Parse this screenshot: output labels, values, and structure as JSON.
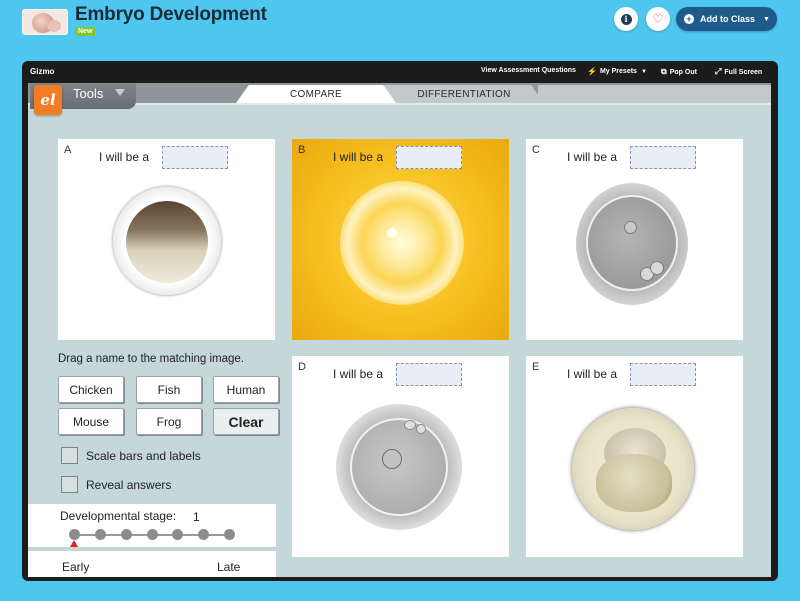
{
  "header": {
    "title": "Embryo Development",
    "badge": "New",
    "add_to_class": "Add to Class"
  },
  "gizmo_bar": {
    "label": "Gizmo",
    "view_questions": "View Assessment Questions",
    "my_presets": "My Presets",
    "pop_out": "Pop Out",
    "full_screen": "Full Screen"
  },
  "tabs": {
    "tools": "Tools",
    "compare": "COMPARE",
    "differentiation": "DIFFERENTIATION"
  },
  "panels": [
    {
      "letter": "A",
      "prompt": "I will be a",
      "answer": ""
    },
    {
      "letter": "B",
      "prompt": "I will be a",
      "answer": ""
    },
    {
      "letter": "C",
      "prompt": "I will be a",
      "answer": ""
    },
    {
      "letter": "D",
      "prompt": "I will be a",
      "answer": ""
    },
    {
      "letter": "E",
      "prompt": "I will be a",
      "answer": ""
    }
  ],
  "controls": {
    "instruction": "Drag a name to the matching image.",
    "names": [
      "Chicken",
      "Fish",
      "Human",
      "Mouse",
      "Frog"
    ],
    "clear": "Clear",
    "scale_bars": "Scale bars and labels",
    "reveal": "Reveal answers",
    "scale_bars_checked": false,
    "reveal_checked": false
  },
  "stage": {
    "label": "Developmental stage:",
    "value": "1",
    "stages_count": 7,
    "early": "Early",
    "late": "Late"
  },
  "colors": {
    "background": "#4fc6f0",
    "frame": "#1c1c1c",
    "workspace": "#c5d7d8",
    "add_class_button": "#1e5b8a",
    "slider_thumb": "#e02222"
  }
}
